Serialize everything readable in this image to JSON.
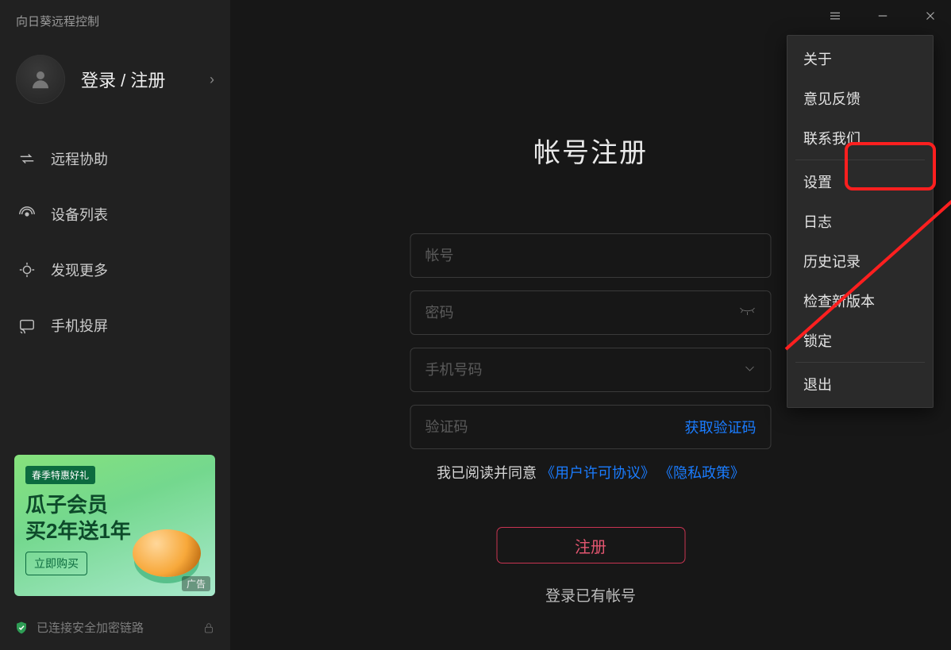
{
  "app_title": "向日葵远程控制",
  "login_register": "登录 / 注册",
  "sidebar": {
    "items": [
      {
        "label": "远程协助"
      },
      {
        "label": "设备列表"
      },
      {
        "label": "发现更多"
      },
      {
        "label": "手机投屏"
      }
    ]
  },
  "promo": {
    "tag": "春季特惠好礼",
    "line1": "瓜子会员",
    "line2": "买2年送1年",
    "button": "立即购买",
    "ad_label": "广告"
  },
  "status_text": "已连接安全加密链路",
  "form": {
    "title": "帐号注册",
    "account_ph": "帐号",
    "password_ph": "密码",
    "phone_ph": "手机号码",
    "captcha_ph": "验证码",
    "get_code": "获取验证码",
    "agree_prefix": "我已阅读并同意 ",
    "agree_link1": "《用户许可协议》",
    "agree_link2": "《隐私政策》",
    "register_btn": "注册",
    "login_existing": "登录已有帐号"
  },
  "menu": {
    "items": [
      "关于",
      "意见反馈",
      "联系我们",
      "设置",
      "日志",
      "历史记录",
      "检查新版本",
      "锁定",
      "退出"
    ]
  }
}
